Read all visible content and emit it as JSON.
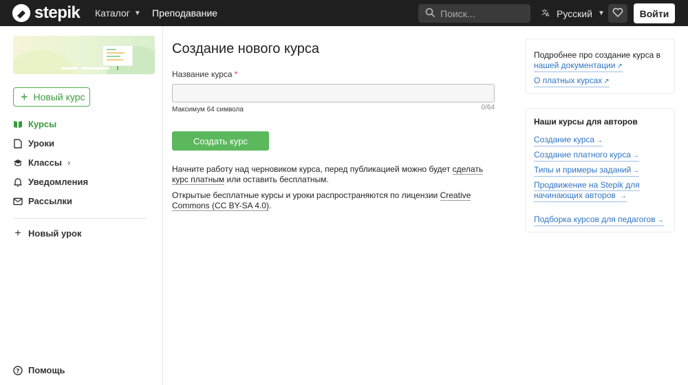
{
  "header": {
    "logo_text": "stepik",
    "catalog_label": "Каталог",
    "teaching_label": "Преподавание",
    "search_placeholder": "Поиск...",
    "language_label": "Русский",
    "login_label": "Войти"
  },
  "sidebar": {
    "new_course_label": "Новый курс",
    "items": [
      {
        "label": "Курсы",
        "icon": "book-icon",
        "active": true
      },
      {
        "label": "Уроки",
        "icon": "document-icon",
        "active": false
      },
      {
        "label": "Классы",
        "icon": "graduation-cap-icon",
        "active": false
      },
      {
        "label": "Уведомления",
        "icon": "bell-icon",
        "active": false
      },
      {
        "label": "Рассылки",
        "icon": "mail-icon",
        "active": false
      }
    ],
    "new_lesson_label": "Новый урок",
    "help_label": "Помощь"
  },
  "main": {
    "title": "Создание нового курса",
    "field_label": "Название курса",
    "field_required_mark": "*",
    "field_value": "",
    "field_hint": "Максимум 64 символа",
    "field_counter": "0/64",
    "create_button": "Создать курс",
    "para1_prefix": "Начните работу над черновиком курса, перед публикацией можно будет ",
    "para1_link": "сделать курс платным",
    "para1_suffix": " или оставить бесплатным.",
    "para2_prefix": "Открытые бесплатные курсы и уроки распространяются по лицензии ",
    "para2_link": "Creative Commons (CC BY-SA 4.0)",
    "para2_suffix": "."
  },
  "right": {
    "panel1": {
      "text": "Подробнее про создание курса в",
      "link_docs": "нашей документации",
      "link_paid": "О платных курсах"
    },
    "panel2": {
      "title": "Наши курсы для авторов",
      "links": [
        "Создание курса",
        "Создание платного курса",
        "Типы и примеры заданий",
        "Продвижение на Stepik для",
        "начинающих авторов",
        "Подборка курсов для педагогов"
      ]
    }
  },
  "colors": {
    "topbar": "#1f1f1f",
    "accent_green": "#5bb85d",
    "link_blue": "#2f74c4"
  }
}
